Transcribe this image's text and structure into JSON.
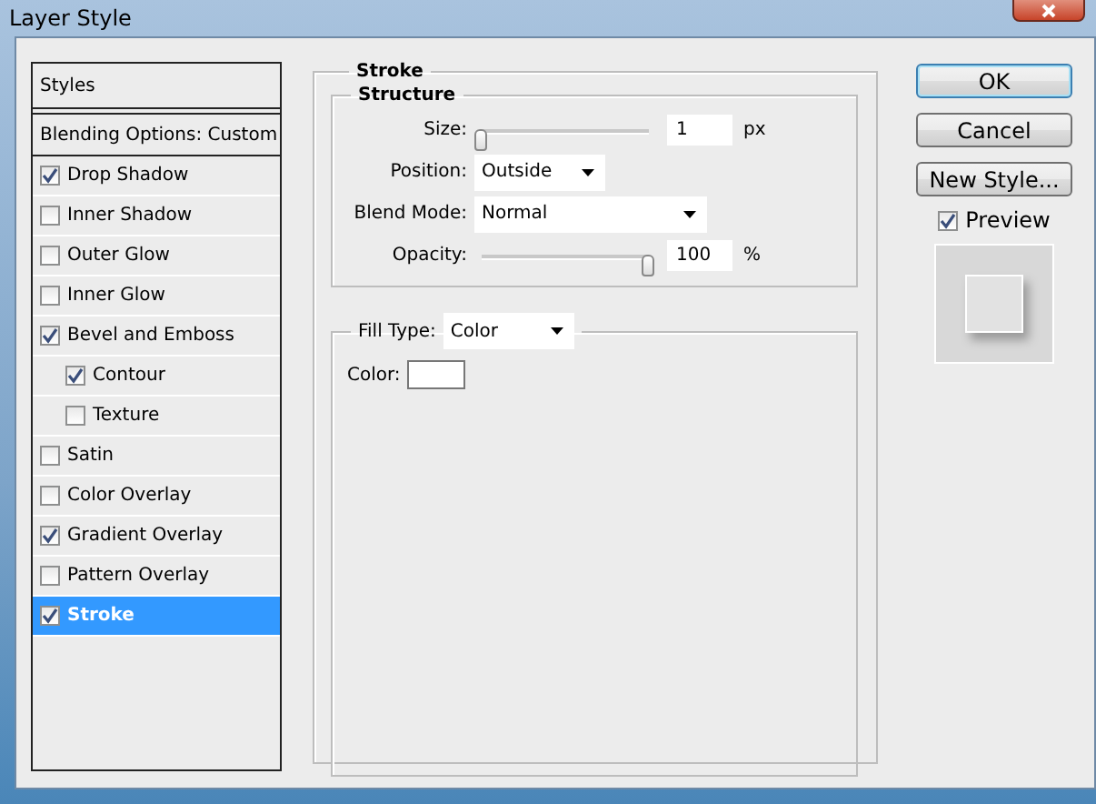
{
  "window": {
    "title": "Layer Style"
  },
  "styles_panel": {
    "header": "Styles",
    "blending": "Blending Options: Custom",
    "items": [
      {
        "label": "Drop Shadow",
        "checked": true,
        "selected": false
      },
      {
        "label": "Inner Shadow",
        "checked": false,
        "selected": false
      },
      {
        "label": "Outer Glow",
        "checked": false,
        "selected": false
      },
      {
        "label": "Inner Glow",
        "checked": false,
        "selected": false
      },
      {
        "label": "Bevel and Emboss",
        "checked": true,
        "selected": false,
        "children": [
          {
            "label": "Contour",
            "checked": true,
            "selected": false
          },
          {
            "label": "Texture",
            "checked": false,
            "selected": false
          }
        ]
      },
      {
        "label": "Satin",
        "checked": false,
        "selected": false
      },
      {
        "label": "Color Overlay",
        "checked": false,
        "selected": false
      },
      {
        "label": "Gradient Overlay",
        "checked": true,
        "selected": false
      },
      {
        "label": "Pattern Overlay",
        "checked": false,
        "selected": false
      },
      {
        "label": "Stroke",
        "checked": true,
        "selected": true
      }
    ]
  },
  "stroke": {
    "title": "Stroke",
    "structure": {
      "title": "Structure",
      "size": {
        "label": "Size:",
        "level": 0,
        "value": "1",
        "unit": "px"
      },
      "position": {
        "label": "Position:",
        "value": "Outside"
      },
      "blend_mode": {
        "label": "Blend Mode:",
        "value": "Normal"
      },
      "opacity": {
        "label": "Opacity:",
        "level": 1,
        "value": "100",
        "unit": "%"
      }
    },
    "fill_type": {
      "label": "Fill Type:",
      "value": "Color"
    },
    "color": {
      "label": "Color:",
      "color": "#ffffff"
    }
  },
  "buttons": [
    {
      "label": "OK",
      "default": true
    },
    {
      "label": "Cancel",
      "default": false
    },
    {
      "label": "New Style...",
      "default": false
    }
  ],
  "preview": {
    "label": "Preview",
    "checked": true
  }
}
